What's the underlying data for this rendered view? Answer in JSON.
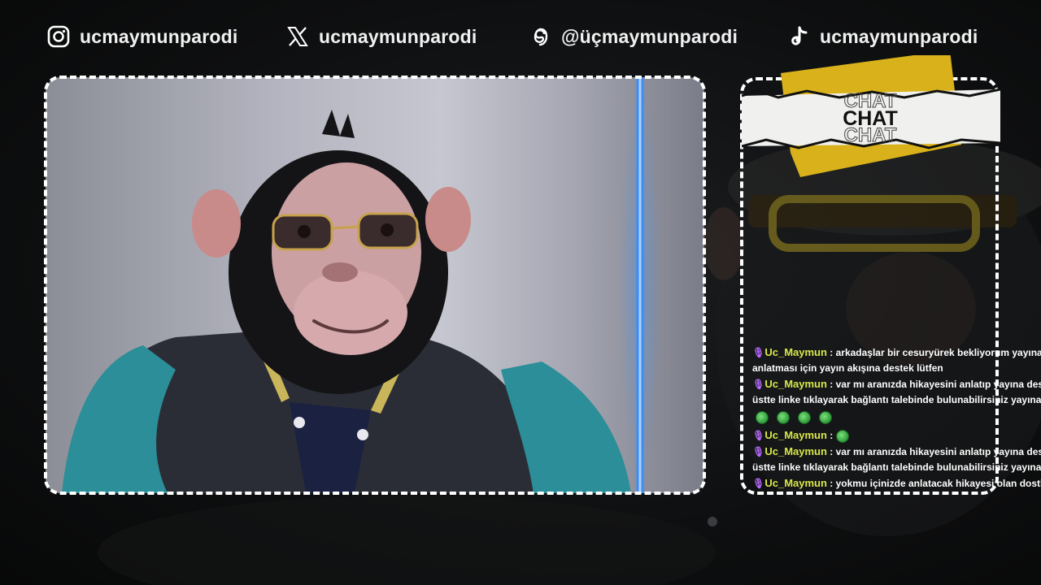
{
  "socials": [
    {
      "icon": "instagram-icon",
      "handle": "ucmaymunparodi"
    },
    {
      "icon": "x-twitter-icon",
      "handle": "ucmaymunparodi"
    },
    {
      "icon": "threads-icon",
      "handle": "@üçmaymunparodi"
    },
    {
      "icon": "tiktok-icon",
      "handle": "ucmaymunparodi"
    }
  ],
  "chat": {
    "header": {
      "line1": "CHAT",
      "line2": "CHAT",
      "line3": "CHAT"
    },
    "messages": [
      {
        "user": "Uc_Maymun",
        "sep": " : ",
        "text": "arkadaşlar bir cesuryürek bekliyorum yayına bağ"
      },
      {
        "continuation": "anlatması için yayın akışına destek lütfen"
      },
      {
        "user": "Uc_Maymun",
        "sep": " : ",
        "text": "var mı aranızda hikayesini anlatıp yayına destek"
      },
      {
        "continuation": "üstte linke tıklayarak bağlantı talebinde bulunabilirsiniz yayına ba"
      },
      {
        "user": "Uc_Maymun",
        "sep": " : ",
        "text": "var mı aranızda hikayesini anlatıp yayına destek"
      },
      {
        "continuation": "üstte linke tıklayarak bağlantı talebinde bulunabilirsiniz yayına ba"
      },
      {
        "user": "Uc_Maymun",
        "sep": " : ",
        "text": "yokmu içinizde anlatacak hikayesi olan dostlar"
      }
    ],
    "emote_user": "Uc_Maymun",
    "emote_sep": " : "
  },
  "colors": {
    "username": "#d8e84a",
    "neon": "#2f8bff",
    "accent_yellow": "#d9b21b"
  }
}
